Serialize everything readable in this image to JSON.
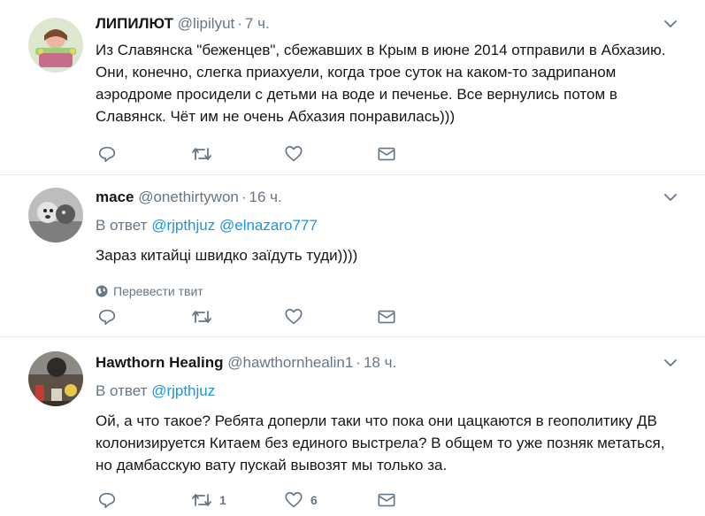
{
  "tweets": [
    {
      "name": "ЛИПИЛЮТ",
      "handle": "@lipilyut",
      "time": "7 ч.",
      "text": "Из Славянска \"беженцев\", сбежавших в Крым в июне 2014 отправили в Абхазию. Они, конечно, слегка приахуели, когда трое суток на каком-то задрипаном аэродроме  просидели с детьми на воде и печенье. Все вернулись потом в Славянск. Чёт им не очень Абхазия понравилась)))",
      "retweets": "",
      "likes": ""
    },
    {
      "name": "mace",
      "handle": "@onethirtywon",
      "time": "16 ч.",
      "reply_prefix": "В ответ",
      "mentions": [
        "@rjpthjuz",
        "@elnazaro777"
      ],
      "text": "Зараз китайці швидко заїдуть туди))))",
      "translate": "Перевести твит",
      "retweets": "",
      "likes": ""
    },
    {
      "name": "Hawthorn Healing",
      "handle": "@hawthornhealin1",
      "time": "18 ч.",
      "reply_prefix": "В ответ",
      "mentions": [
        "@rjpthjuz"
      ],
      "text": "Ой, а что такое? Ребята доперли таки что пока они цацкаются в геополитику ДВ колонизируется Китаем без единого выстрела? В общем то уже позняк метаться, но дамбасскую вату пускай вывозят мы только за.",
      "retweets": "1",
      "likes": "6"
    }
  ],
  "colors": {
    "text": "#14171a",
    "secondary": "#657786",
    "link": "#1b95e0",
    "divider": "#e6ecf0"
  },
  "icons": {
    "reply": "reply-icon",
    "retweet": "retweet-icon",
    "like": "heart-icon",
    "dm": "envelope-icon",
    "more": "chevron-down-icon",
    "globe": "globe-icon"
  }
}
